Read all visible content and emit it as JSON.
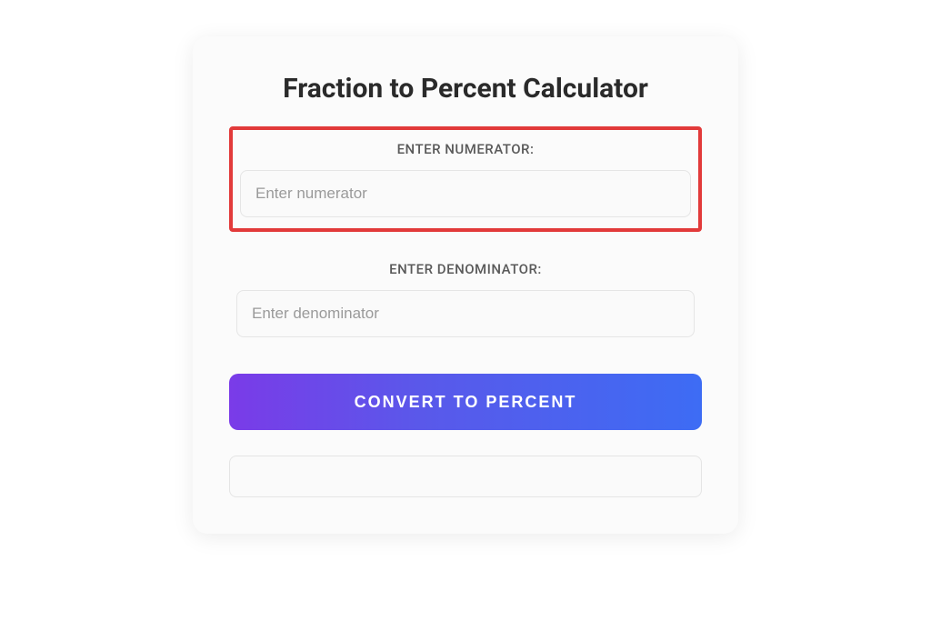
{
  "title": "Fraction to Percent Calculator",
  "numerator": {
    "label": "ENTER NUMERATOR:",
    "placeholder": "Enter numerator",
    "value": ""
  },
  "denominator": {
    "label": "ENTER DENOMINATOR:",
    "placeholder": "Enter denominator",
    "value": ""
  },
  "button": {
    "label": "CONVERT TO PERCENT"
  },
  "result": {
    "value": ""
  }
}
